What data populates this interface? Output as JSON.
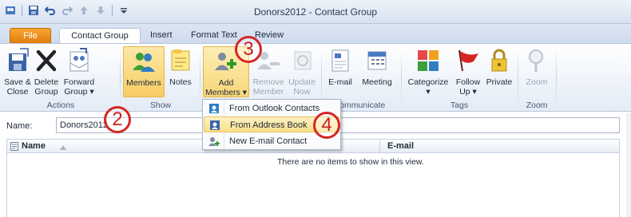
{
  "window": {
    "title": "Donors2012  -  Contact Group"
  },
  "tabs": [
    {
      "label": "File"
    },
    {
      "label": "Contact Group"
    },
    {
      "label": "Insert"
    },
    {
      "label": "Format Text"
    },
    {
      "label": "Review"
    }
  ],
  "ribbon": {
    "actions": {
      "label": "Actions",
      "save_close": [
        "Save &",
        "Close"
      ],
      "delete_group": [
        "Delete",
        "Group"
      ],
      "forward_group": [
        "Forward",
        "Group ▾"
      ]
    },
    "show": {
      "label": "Show",
      "members": "Members",
      "notes": "Notes"
    },
    "members_group": {
      "add_members": [
        "Add",
        "Members ▾"
      ],
      "remove_member": [
        "Remove",
        "Member"
      ],
      "update_now": [
        "Update",
        "Now"
      ]
    },
    "communicate": {
      "label": "Communicate",
      "email": "E-mail",
      "meeting": "Meeting"
    },
    "tags": {
      "label": "Tags",
      "categorize": [
        "Categorize",
        "▾"
      ],
      "follow_up": [
        "Follow",
        "Up ▾"
      ],
      "private": "Private"
    },
    "zoom": {
      "label": "Zoom",
      "zoom": "Zoom"
    }
  },
  "dropdown": {
    "items": [
      {
        "label": "From Outlook Contacts",
        "icon": "outlook-contacts-icon"
      },
      {
        "label": "From Address Book",
        "icon": "address-book-icon",
        "highlighted": true
      },
      {
        "label": "New E-mail Contact",
        "icon": "new-contact-icon"
      }
    ]
  },
  "form": {
    "name_label": "Name:",
    "name_value": "Donors2012"
  },
  "grid": {
    "columns": [
      "Name",
      "E-mail"
    ],
    "empty_message": "There are no items to show in this view."
  },
  "callouts": [
    "2",
    "3",
    "4"
  ],
  "colors": {
    "accent": "#e07d0d",
    "highlight": "#f8cc63",
    "callout": "#d52626"
  }
}
